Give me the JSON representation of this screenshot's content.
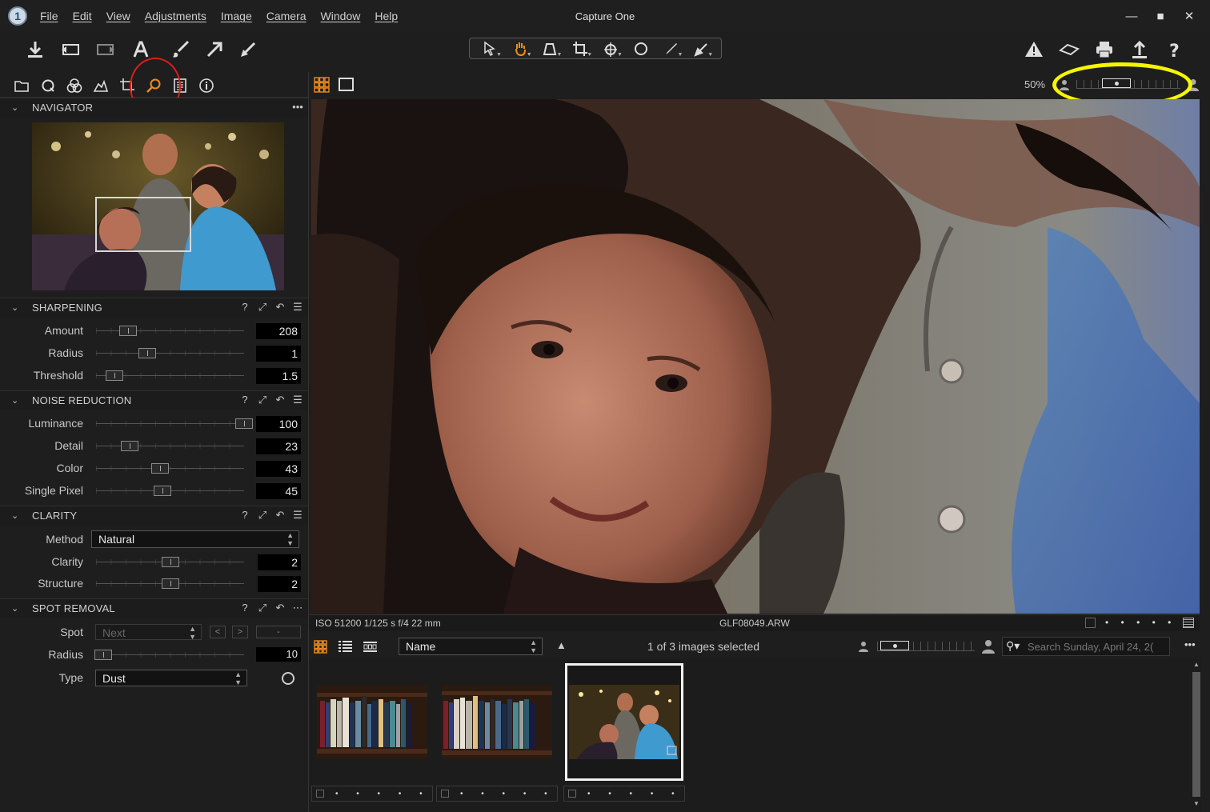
{
  "window": {
    "title": "Capture One",
    "logo": "1",
    "menu": [
      "File",
      "Edit",
      "View",
      "Adjustments",
      "Image",
      "Camera",
      "Window",
      "Help"
    ],
    "controls": [
      "minimize",
      "maximize",
      "close"
    ]
  },
  "toolbar": {
    "left_icons": [
      "import-icon",
      "capture-icon",
      "process-icon",
      "text-icon",
      "brush-icon",
      "arrow-icon",
      "ruler-icon"
    ],
    "cursor_tools": [
      "select-icon",
      "hand-pan-icon",
      "keystone-icon",
      "crop-icon",
      "rotate-icon",
      "circle-icon",
      "color-picker-icon",
      "eraser-icon"
    ],
    "right_icons": [
      "warning-icon",
      "compare-icon",
      "print-icon",
      "export-icon",
      "help-icon"
    ]
  },
  "tool_tabs": {
    "icons": [
      "library-icon",
      "capture-tab-icon",
      "color-icon",
      "exposure-icon",
      "lens-icon",
      "details-icon",
      "metadata-icon",
      "info-icon"
    ],
    "active": "details-icon"
  },
  "navigator": {
    "title": "NAVIGATOR",
    "menu": "•••"
  },
  "sharpening": {
    "title": "SHARPENING",
    "rows": [
      {
        "label": "Amount",
        "value": "208"
      },
      {
        "label": "Radius",
        "value": "1"
      },
      {
        "label": "Threshold",
        "value": "1.5"
      }
    ]
  },
  "noise_reduction": {
    "title": "NOISE REDUCTION",
    "rows": [
      {
        "label": "Luminance",
        "value": "100"
      },
      {
        "label": "Detail",
        "value": "23"
      },
      {
        "label": "Color",
        "value": "43"
      },
      {
        "label": "Single Pixel",
        "value": "45"
      }
    ]
  },
  "clarity": {
    "title": "CLARITY",
    "method_label": "Method",
    "method_value": "Natural",
    "rows": [
      {
        "label": "Clarity",
        "value": "2"
      },
      {
        "label": "Structure",
        "value": "2"
      }
    ]
  },
  "spot_removal": {
    "title": "SPOT REMOVAL",
    "spot_label": "Spot",
    "spot_value": "Next",
    "prev": "<",
    "next": ">",
    "spot_extra": "-",
    "radius_label": "Radius",
    "radius_value": "10",
    "type_label": "Type",
    "type_value": "Dust"
  },
  "viewer": {
    "zoom": "50%",
    "status_exposure": "ISO 51200 1/125 s f/4 22 mm",
    "status_filename": "GLF08049.ARW",
    "status_dots": "• • • • •"
  },
  "browser": {
    "sort_by": "Name",
    "selection": "1 of 3 images selected",
    "search_placeholder": "Search Sunday, April 24, 2(",
    "menu": "•••",
    "thumbnails": [
      {
        "selected": false,
        "dots": "• • • • •"
      },
      {
        "selected": false,
        "dots": "• • • • •"
      },
      {
        "selected": true,
        "dots": "• • • • •"
      }
    ]
  },
  "colors": {
    "accent": "#f08c1c",
    "annotation_red": "#e01b1b",
    "annotation_yellow": "#f5f500",
    "panel_bg": "#1e1e1e"
  }
}
